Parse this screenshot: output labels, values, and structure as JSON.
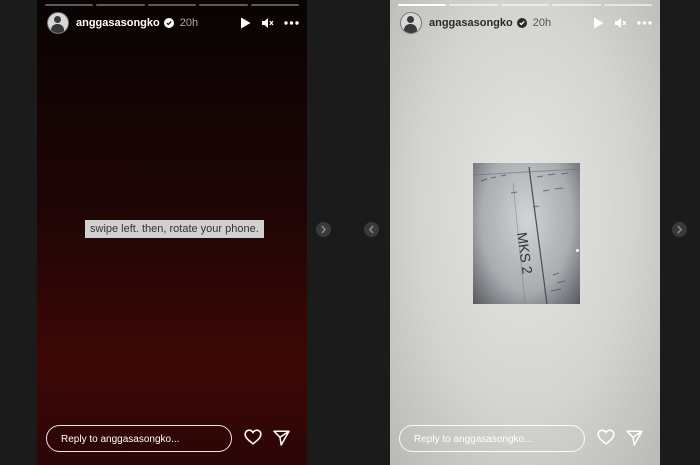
{
  "stories": [
    {
      "username": "anggasasongko",
      "time": "20h",
      "text_sticker": "swipe left. then, rotate your phone.",
      "reply_placeholder": "Reply to anggasasongko..."
    },
    {
      "username": "anggasasongko",
      "time": "20h",
      "photo_text": "MKS 2",
      "reply_placeholder": "Reply to anggasasongko..."
    }
  ],
  "colors": {
    "page_background": "#1b1b1b",
    "story1_gradient": [
      "#090303",
      "#3d0807"
    ],
    "story2_background": "#d4d4d0",
    "sticker_background": "#d0d0d0"
  },
  "icons": [
    "verified-badge-icon",
    "play-icon",
    "mute-icon",
    "more-icon",
    "heart-icon",
    "send-icon",
    "chevron-left-icon",
    "chevron-right-icon"
  ]
}
